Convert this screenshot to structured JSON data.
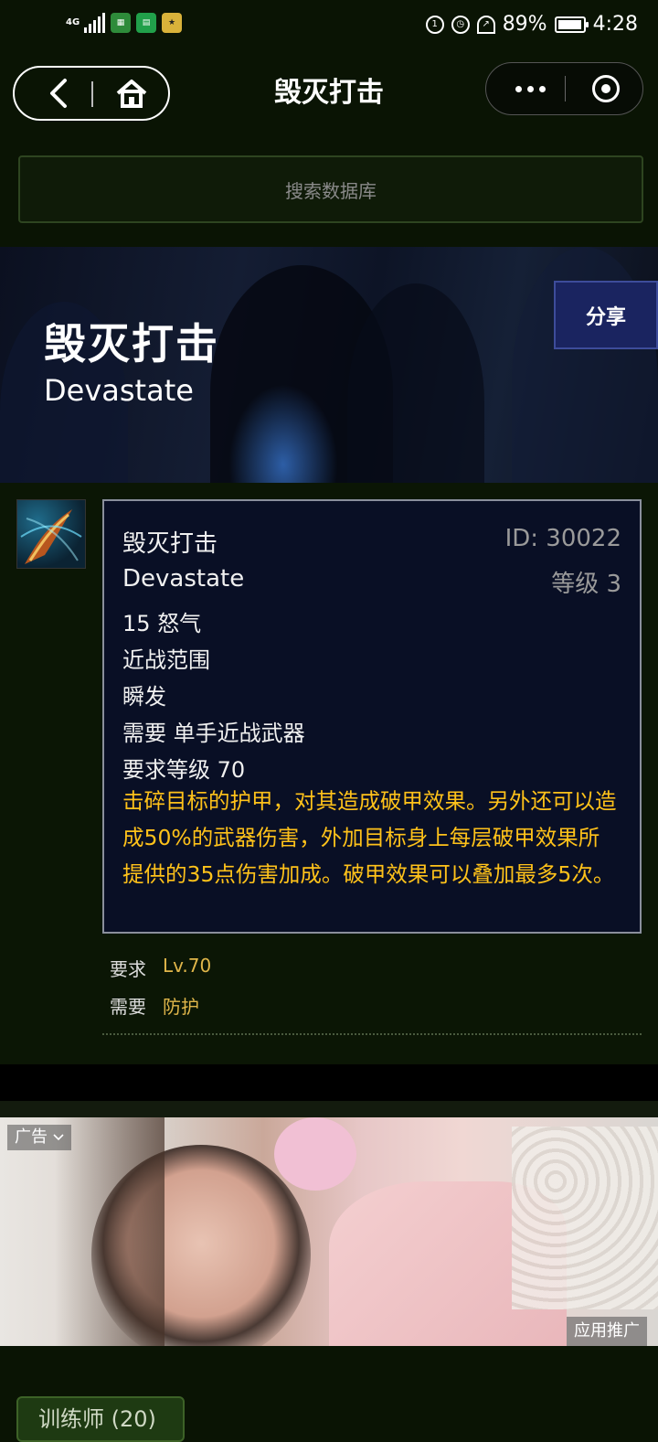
{
  "status_bar": {
    "network": "4G",
    "battery": "89%",
    "battery_level": 0.89,
    "time": "4:28",
    "apps": [
      "app1",
      "app2",
      "app3"
    ]
  },
  "nav": {
    "title": "毁灭打击",
    "back_icon": "chevron-left-icon",
    "home_icon": "home-icon",
    "more_icon": "more-dots-icon",
    "close_icon": "target-icon"
  },
  "search": {
    "placeholder": "搜索数据库"
  },
  "hero": {
    "title": "毁灭打击",
    "subtitle": "Devastate",
    "share_label": "分享"
  },
  "tooltip": {
    "name_cn": "毁灭打击",
    "id": "ID: 30022",
    "name_en": "Devastate",
    "rank": "等级 3",
    "cost": "15 怒气",
    "range": "近战范围",
    "cast": "瞬发",
    "requires_weapon": "需要 单手近战武器",
    "required_level": "要求等级 70",
    "description": "击碎目标的护甲，对其造成破甲效果。另外还可以造成50%的武器伤害，外加目标身上每层破甲效果所提供的35点伤害加成。破甲效果可以叠加最多5次。",
    "desc_color": "#ffc21a"
  },
  "requirements": {
    "level_label": "要求",
    "level_value": "Lv.70",
    "needs_label": "需要",
    "needs_value": "防护"
  },
  "ad": {
    "label": "广告",
    "promo": "应用推广"
  },
  "bottom": {
    "trainer_button": "训练师 (20)"
  }
}
